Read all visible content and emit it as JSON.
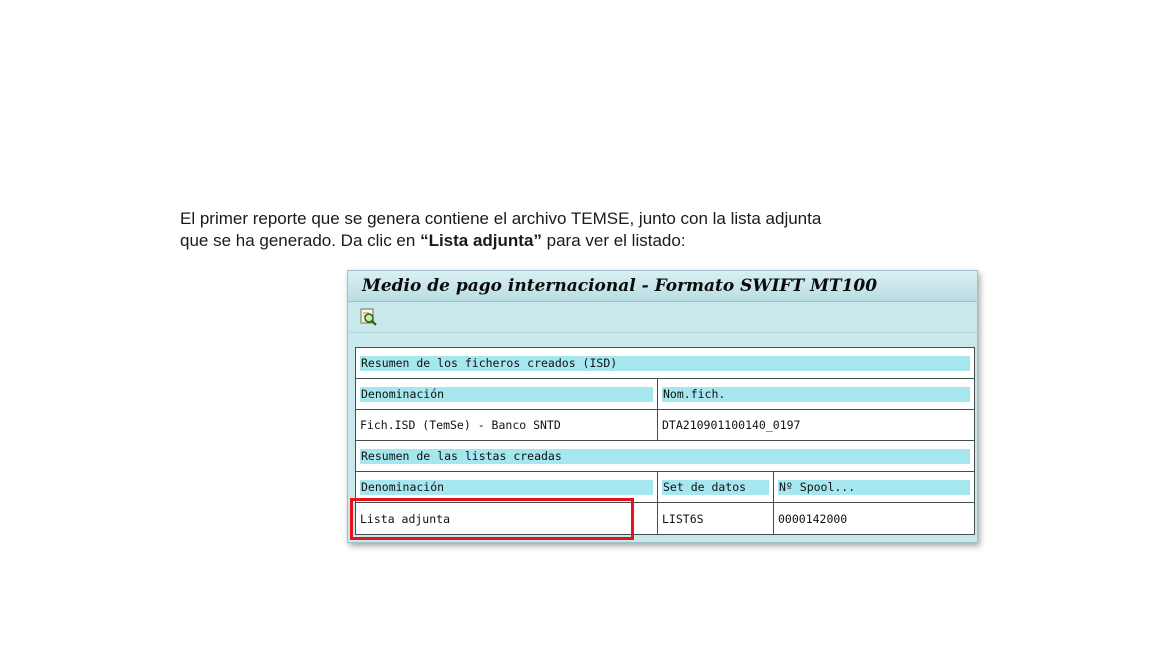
{
  "instructions": {
    "line1": "El primer reporte que se genera contiene el archivo TEMSE, junto con la lista adjunta",
    "line2_before": "que se ha generado. Da clic en ",
    "line2_bold": "“Lista adjunta”",
    "line2_after": " para ver el listado:"
  },
  "window": {
    "title": "Medio de pago internacional - Formato SWIFT MT100",
    "toolbar_icon": "detail-magnifier-icon"
  },
  "files_section": {
    "title": "Resumen de los ficheros creados (ISD)",
    "headers": [
      "Denominación",
      "Nom.fich."
    ],
    "rows": [
      [
        "Fich.ISD (TemSe) - Banco SNTD",
        "DTA210901100140_0197"
      ]
    ]
  },
  "lists_section": {
    "title": "Resumen de las listas creadas",
    "headers": [
      "Denominación",
      "Set de datos",
      "Nº Spool..."
    ],
    "rows": [
      [
        "Lista adjunta",
        "LIST6S",
        "0000142000"
      ]
    ]
  },
  "colors": {
    "highlight": "#e8121a",
    "header_fill": "#a6e6ee",
    "window_bg": "#c9e8ec"
  }
}
